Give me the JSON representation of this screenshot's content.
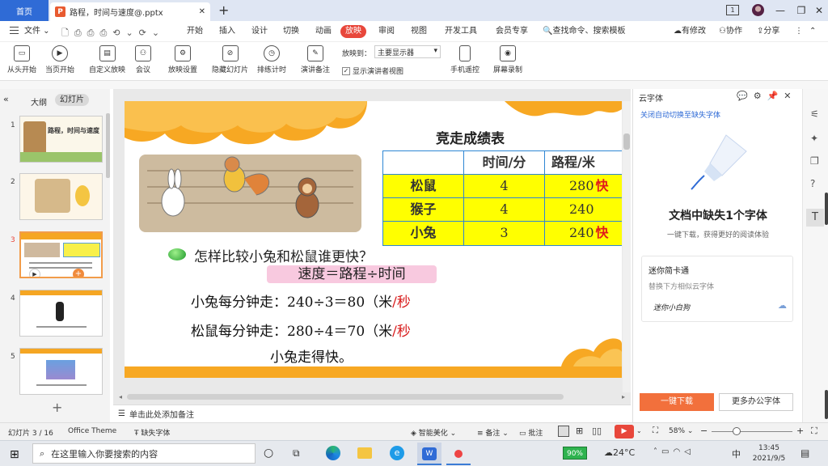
{
  "titlebar": {
    "home_tab": "首页",
    "doc_tab": "路程，时间与速度@.pptx",
    "new_tab": "+",
    "page_badge": "1"
  },
  "menu": {
    "file": "文件",
    "items": [
      "开始",
      "插入",
      "设计",
      "切换",
      "动画",
      "放映",
      "审阅",
      "视图",
      "开发工具",
      "会员专享"
    ],
    "search": "查找命令、搜索模板",
    "has_changes": "有修改",
    "collab": "协作",
    "share": "分享"
  },
  "ribbon": {
    "buttons": [
      "从头开始",
      "当页开始",
      "自定义放映",
      "会议",
      "放映设置",
      "隐藏幻灯片",
      "排练计时",
      "演讲备注",
      "手机遥控",
      "屏幕录制"
    ],
    "play_to_label": "放映到：",
    "play_to_value": "主要显示器",
    "presenter_view": "显示演讲者视图"
  },
  "left": {
    "outline_tab": "大纲",
    "slides_tab": "幻灯片",
    "thumb1": "路程，时间与速度",
    "thumb_numbers": [
      "1",
      "2",
      "3",
      "4",
      "5"
    ]
  },
  "slide": {
    "table_title": "竞走成绩表",
    "headers": [
      "",
      "时间/分",
      "路程/米"
    ],
    "rows": [
      {
        "name": "松鼠",
        "time": "4",
        "dist": "280",
        "mark": "快"
      },
      {
        "name": "猴子",
        "time": "4",
        "dist": "240",
        "mark": ""
      },
      {
        "name": "小兔",
        "time": "3",
        "dist": "240",
        "mark": "快"
      }
    ],
    "question": "怎样比较小兔和松鼠谁更快？",
    "formula": "速度＝路程÷时间",
    "line1": "小兔每分钟走：240÷3＝80（米",
    "line1_unit": "/秒",
    "line2": "松鼠每分钟走：280÷4＝70（米",
    "line2_unit": "/秒",
    "conclusion": "小兔走得快。"
  },
  "notes": "单击此处添加备注",
  "right": {
    "title": "云字体",
    "link": "关闭自动切换至缺失字体",
    "heading": "文档中缺失1个字体",
    "sub": "一键下载，获得更好的阅读体验",
    "font_name": "迷你简卡通",
    "font_hint": "替换下方相似云字体",
    "font_preview": "迷你小白狗",
    "download": "一键下载",
    "more": "更多办公字体"
  },
  "status": {
    "slide_pos": "幻灯片 3 / 16",
    "theme": "Office Theme",
    "missing": "缺失字体",
    "beautify": "智能美化",
    "notes": "备注",
    "comments": "批注",
    "zoom": "58%"
  },
  "taskbar": {
    "search": "在这里输入你要搜索的内容",
    "battery": "90%",
    "weather": "24°C",
    "ime": "中",
    "time": "13:45",
    "date": "2021/9/5"
  }
}
